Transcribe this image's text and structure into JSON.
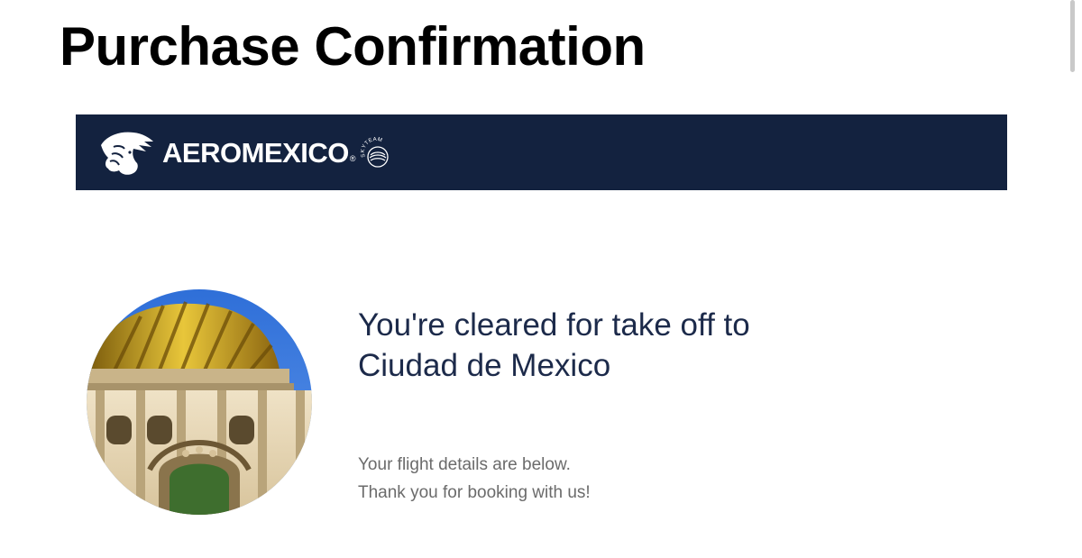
{
  "page": {
    "title": "Purchase Confirmation"
  },
  "banner": {
    "brand_name": "AEROMEXICO",
    "registered_mark": "®",
    "alliance": "SKYTEAM",
    "background_color": "#13223f",
    "logo_icon": "aztec-head-icon",
    "alliance_icon": "skyteam-icon"
  },
  "hero": {
    "image_icon": "palacio-de-bellas-artes-image",
    "heading_line1": "You're cleared for take off to",
    "heading_line2": "Ciudad de Mexico",
    "body_line1": "Your flight details are below.",
    "body_line2": "Thank you for booking with us!"
  },
  "colors": {
    "heading": "#1c2a4a",
    "body_text": "#6b6b6b",
    "title": "#000000"
  }
}
